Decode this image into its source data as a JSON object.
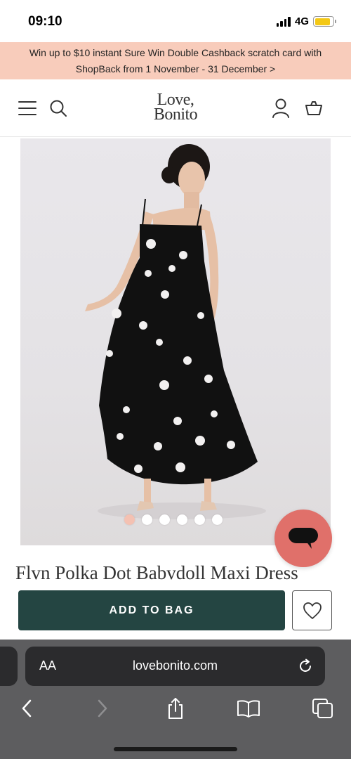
{
  "status_bar": {
    "time": "09:10",
    "network": "4G"
  },
  "promo": {
    "text": "Win up to $10 instant Sure Win Double Cashback scratch card with ShopBack from 1 November - 31 December >"
  },
  "header": {
    "logo_line1": "Love,",
    "logo_line2": "Bonito",
    "icons": [
      "menu-icon",
      "search-icon",
      "account-icon",
      "bag-icon"
    ]
  },
  "product": {
    "title": "Flvn Polka Dot Babvdoll Maxi Dress",
    "image_count": 6,
    "active_image": 1,
    "add_to_bag_label": "ADD TO BAG"
  },
  "browser": {
    "text_size_label": "AA",
    "url": "lovebonito.com",
    "toolbar_icons": [
      "back-icon",
      "forward-icon",
      "share-icon",
      "bookmarks-icon",
      "tabs-icon"
    ]
  },
  "colors": {
    "promo_bg": "#f8ccbb",
    "primary_button": "#244542",
    "chat_fab": "#e0706a",
    "active_dot": "#f4c1b2"
  }
}
